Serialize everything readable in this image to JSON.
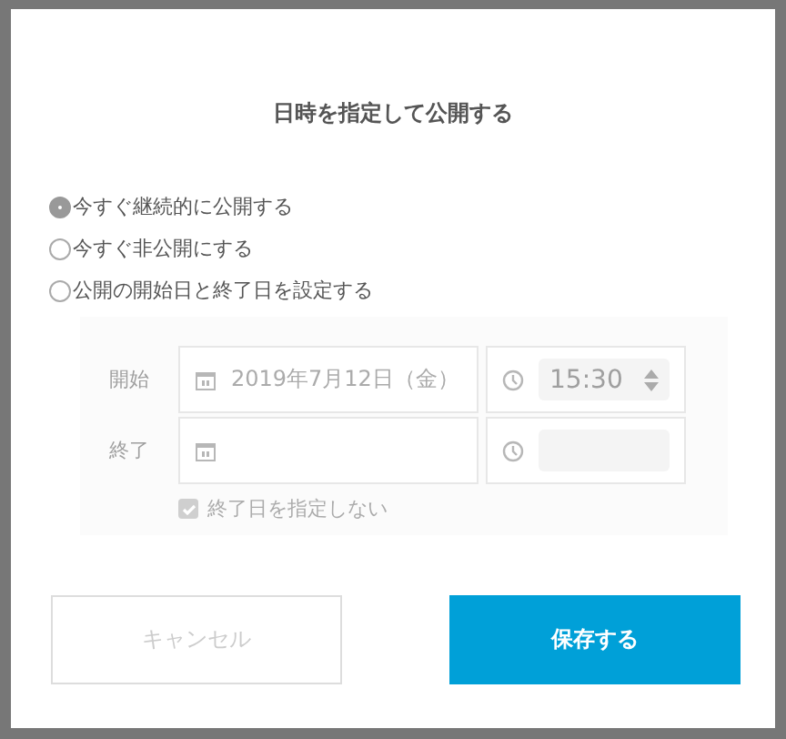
{
  "dialog": {
    "title": "日時を指定して公開する"
  },
  "options": [
    {
      "label": "今すぐ継続的に公開する",
      "selected": true
    },
    {
      "label": "今すぐ非公開にする",
      "selected": false
    },
    {
      "label": "公開の開始日と終了日を設定する",
      "selected": false
    }
  ],
  "schedule": {
    "disabled": true,
    "start": {
      "label": "開始",
      "date": "2019年7月12日（金）",
      "time": "15:30"
    },
    "end": {
      "label": "終了"
    },
    "no_end": {
      "label": "終了日を指定しない",
      "checked": true
    }
  },
  "buttons": [
    {
      "label": "キャンセル",
      "kind": "secondary"
    },
    {
      "label": "保存する",
      "kind": "primary"
    }
  ]
}
